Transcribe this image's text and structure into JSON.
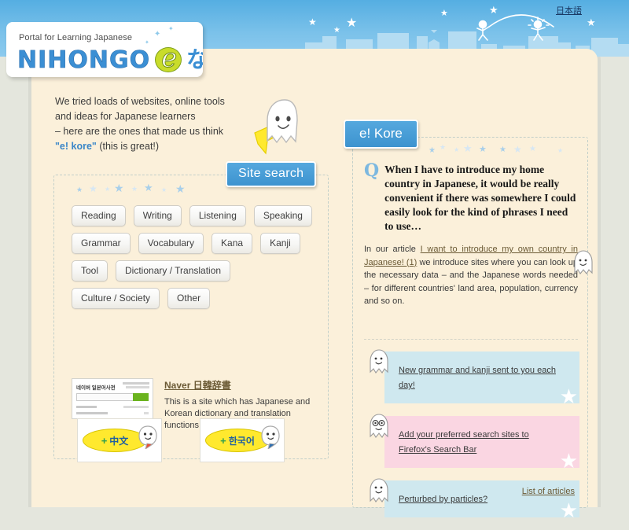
{
  "header": {
    "lang_link": "日本語",
    "skyline_name": "city-skyline"
  },
  "logo": {
    "tagline": "Portal for Learning Japanese",
    "wordmark": "NIHONGO",
    "e_letter": "e",
    "na_char": "な"
  },
  "intro": {
    "line1": "We tried loads of websites, online tools",
    "line2": "and ideas for Japanese learners",
    "line3": "– here are the ones that made us think",
    "highlight": "\"e! kore\"",
    "line4_tail": " (this is great!)"
  },
  "site_search": {
    "tab_label": "Site search",
    "categories": [
      "Reading",
      "Writing",
      "Listening",
      "Speaking",
      "Grammar",
      "Vocabulary",
      "Kana",
      "Kanji",
      "Tool",
      "Dictionary / Translation",
      "Culture / Society",
      "Other"
    ],
    "entry": {
      "thumb_title": "네이버 일본어사전",
      "title": "Naver 日韓辞書",
      "description": "This is a site which has Japanese and Korean dictionary and translation functions."
    }
  },
  "language_buttons": [
    {
      "plus": "+",
      "label": "中文"
    },
    {
      "plus": "+",
      "label": "한국어"
    }
  ],
  "kore": {
    "tab_label": "e! Kore",
    "q_marker": "Q",
    "question": "When I have to introduce my home country in Japanese, it would be really convenient if there was somewhere I could easily look for the kind of phrases I need to use…",
    "answer_pre": "In our article ",
    "answer_link": "I want to introduce my own country in Japanese! (1)",
    "answer_post": " we introduce sites where you can look up the necessary data – and the Japanese words needed – for different countries' land area, population, currency and so on.",
    "articles": [
      {
        "text": "New grammar and kanji sent to you each day!",
        "color": "blue"
      },
      {
        "text": "Add your preferred search sites to Firefox's Search Bar",
        "color": "pink"
      },
      {
        "text": "Perturbed by particles?",
        "color": "blue"
      }
    ],
    "list_link": "List of articles"
  },
  "colors": {
    "sky": "#7cc2ea",
    "page_bg": "#fbf0da",
    "accent_blue": "#3d93cf",
    "logo_blue": "#3b8fd4",
    "logo_green": "#c9dc2b",
    "article_blue": "#cfe8ef",
    "article_pink": "#fad6e2",
    "link_brown": "#6b5a35",
    "lang_yellow": "#ffe92e"
  }
}
